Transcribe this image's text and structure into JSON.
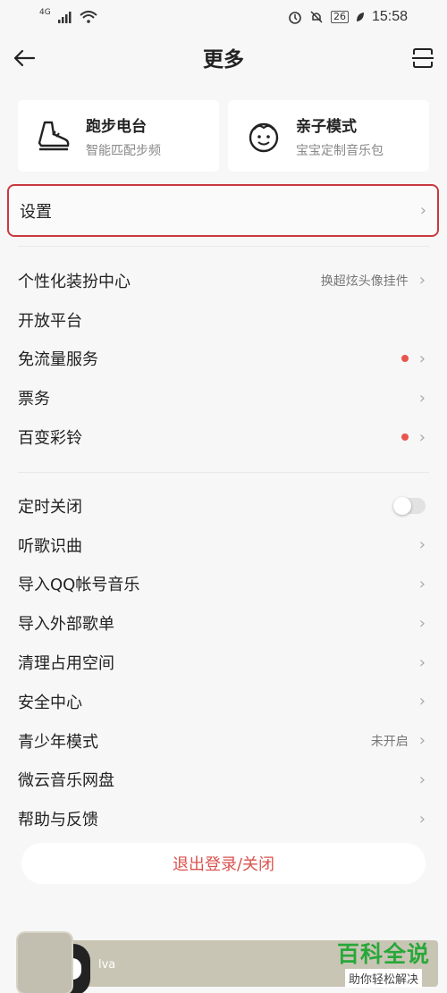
{
  "status_bar": {
    "network": "4G",
    "battery": "26",
    "time": "15:58"
  },
  "header": {
    "title": "更多"
  },
  "cards": [
    {
      "title": "跑步电台",
      "subtitle": "智能匹配步频",
      "icon": "running-shoe-icon"
    },
    {
      "title": "亲子模式",
      "subtitle": "宝宝定制音乐包",
      "icon": "baby-face-icon"
    }
  ],
  "settings": {
    "label": "设置"
  },
  "list1": [
    {
      "label": "个性化装扮中心",
      "value": "换超炫头像挂件",
      "dot": false,
      "chevron": true
    },
    {
      "label": "开放平台",
      "value": "",
      "dot": false,
      "chevron": false
    },
    {
      "label": "免流量服务",
      "value": "",
      "dot": true,
      "chevron": true
    },
    {
      "label": "票务",
      "value": "",
      "dot": false,
      "chevron": true
    },
    {
      "label": "百变彩铃",
      "value": "",
      "dot": true,
      "chevron": true
    }
  ],
  "list2": [
    {
      "label": "定时关闭",
      "toggle": true,
      "toggle_on": false
    },
    {
      "label": "听歌识曲",
      "value": ""
    },
    {
      "label": "导入QQ帐号音乐",
      "value": ""
    },
    {
      "label": "导入外部歌单",
      "value": ""
    },
    {
      "label": "清理占用空间",
      "value": ""
    },
    {
      "label": "安全中心",
      "value": ""
    },
    {
      "label": "青少年模式",
      "value": "未开启"
    },
    {
      "label": "微云音乐网盘",
      "value": ""
    },
    {
      "label": "帮助与反馈",
      "value": ""
    }
  ],
  "logout": {
    "label": "退出登录/关闭"
  },
  "player": {
    "text": "lva"
  },
  "watermark": {
    "title": "百科全说",
    "subtitle": "助你轻松解决"
  },
  "colors": {
    "accent": "#c8393f",
    "logout_text": "#d9534f",
    "dot": "#e8554e",
    "watermark_green": "#29a83a"
  }
}
